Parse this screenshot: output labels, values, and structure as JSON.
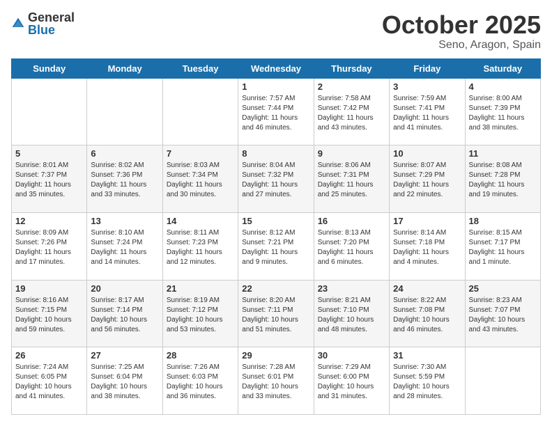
{
  "logo": {
    "general": "General",
    "blue": "Blue"
  },
  "header": {
    "month": "October 2025",
    "location": "Seno, Aragon, Spain"
  },
  "days": [
    "Sunday",
    "Monday",
    "Tuesday",
    "Wednesday",
    "Thursday",
    "Friday",
    "Saturday"
  ],
  "weeks": [
    [
      {
        "day": "",
        "sunrise": "",
        "sunset": "",
        "daylight": ""
      },
      {
        "day": "",
        "sunrise": "",
        "sunset": "",
        "daylight": ""
      },
      {
        "day": "",
        "sunrise": "",
        "sunset": "",
        "daylight": ""
      },
      {
        "day": "1",
        "sunrise": "Sunrise: 7:57 AM",
        "sunset": "Sunset: 7:44 PM",
        "daylight": "Daylight: 11 hours and 46 minutes."
      },
      {
        "day": "2",
        "sunrise": "Sunrise: 7:58 AM",
        "sunset": "Sunset: 7:42 PM",
        "daylight": "Daylight: 11 hours and 43 minutes."
      },
      {
        "day": "3",
        "sunrise": "Sunrise: 7:59 AM",
        "sunset": "Sunset: 7:41 PM",
        "daylight": "Daylight: 11 hours and 41 minutes."
      },
      {
        "day": "4",
        "sunrise": "Sunrise: 8:00 AM",
        "sunset": "Sunset: 7:39 PM",
        "daylight": "Daylight: 11 hours and 38 minutes."
      }
    ],
    [
      {
        "day": "5",
        "sunrise": "Sunrise: 8:01 AM",
        "sunset": "Sunset: 7:37 PM",
        "daylight": "Daylight: 11 hours and 35 minutes."
      },
      {
        "day": "6",
        "sunrise": "Sunrise: 8:02 AM",
        "sunset": "Sunset: 7:36 PM",
        "daylight": "Daylight: 11 hours and 33 minutes."
      },
      {
        "day": "7",
        "sunrise": "Sunrise: 8:03 AM",
        "sunset": "Sunset: 7:34 PM",
        "daylight": "Daylight: 11 hours and 30 minutes."
      },
      {
        "day": "8",
        "sunrise": "Sunrise: 8:04 AM",
        "sunset": "Sunset: 7:32 PM",
        "daylight": "Daylight: 11 hours and 27 minutes."
      },
      {
        "day": "9",
        "sunrise": "Sunrise: 8:06 AM",
        "sunset": "Sunset: 7:31 PM",
        "daylight": "Daylight: 11 hours and 25 minutes."
      },
      {
        "day": "10",
        "sunrise": "Sunrise: 8:07 AM",
        "sunset": "Sunset: 7:29 PM",
        "daylight": "Daylight: 11 hours and 22 minutes."
      },
      {
        "day": "11",
        "sunrise": "Sunrise: 8:08 AM",
        "sunset": "Sunset: 7:28 PM",
        "daylight": "Daylight: 11 hours and 19 minutes."
      }
    ],
    [
      {
        "day": "12",
        "sunrise": "Sunrise: 8:09 AM",
        "sunset": "Sunset: 7:26 PM",
        "daylight": "Daylight: 11 hours and 17 minutes."
      },
      {
        "day": "13",
        "sunrise": "Sunrise: 8:10 AM",
        "sunset": "Sunset: 7:24 PM",
        "daylight": "Daylight: 11 hours and 14 minutes."
      },
      {
        "day": "14",
        "sunrise": "Sunrise: 8:11 AM",
        "sunset": "Sunset: 7:23 PM",
        "daylight": "Daylight: 11 hours and 12 minutes."
      },
      {
        "day": "15",
        "sunrise": "Sunrise: 8:12 AM",
        "sunset": "Sunset: 7:21 PM",
        "daylight": "Daylight: 11 hours and 9 minutes."
      },
      {
        "day": "16",
        "sunrise": "Sunrise: 8:13 AM",
        "sunset": "Sunset: 7:20 PM",
        "daylight": "Daylight: 11 hours and 6 minutes."
      },
      {
        "day": "17",
        "sunrise": "Sunrise: 8:14 AM",
        "sunset": "Sunset: 7:18 PM",
        "daylight": "Daylight: 11 hours and 4 minutes."
      },
      {
        "day": "18",
        "sunrise": "Sunrise: 8:15 AM",
        "sunset": "Sunset: 7:17 PM",
        "daylight": "Daylight: 11 hours and 1 minute."
      }
    ],
    [
      {
        "day": "19",
        "sunrise": "Sunrise: 8:16 AM",
        "sunset": "Sunset: 7:15 PM",
        "daylight": "Daylight: 10 hours and 59 minutes."
      },
      {
        "day": "20",
        "sunrise": "Sunrise: 8:17 AM",
        "sunset": "Sunset: 7:14 PM",
        "daylight": "Daylight: 10 hours and 56 minutes."
      },
      {
        "day": "21",
        "sunrise": "Sunrise: 8:19 AM",
        "sunset": "Sunset: 7:12 PM",
        "daylight": "Daylight: 10 hours and 53 minutes."
      },
      {
        "day": "22",
        "sunrise": "Sunrise: 8:20 AM",
        "sunset": "Sunset: 7:11 PM",
        "daylight": "Daylight: 10 hours and 51 minutes."
      },
      {
        "day": "23",
        "sunrise": "Sunrise: 8:21 AM",
        "sunset": "Sunset: 7:10 PM",
        "daylight": "Daylight: 10 hours and 48 minutes."
      },
      {
        "day": "24",
        "sunrise": "Sunrise: 8:22 AM",
        "sunset": "Sunset: 7:08 PM",
        "daylight": "Daylight: 10 hours and 46 minutes."
      },
      {
        "day": "25",
        "sunrise": "Sunrise: 8:23 AM",
        "sunset": "Sunset: 7:07 PM",
        "daylight": "Daylight: 10 hours and 43 minutes."
      }
    ],
    [
      {
        "day": "26",
        "sunrise": "Sunrise: 7:24 AM",
        "sunset": "Sunset: 6:05 PM",
        "daylight": "Daylight: 10 hours and 41 minutes."
      },
      {
        "day": "27",
        "sunrise": "Sunrise: 7:25 AM",
        "sunset": "Sunset: 6:04 PM",
        "daylight": "Daylight: 10 hours and 38 minutes."
      },
      {
        "day": "28",
        "sunrise": "Sunrise: 7:26 AM",
        "sunset": "Sunset: 6:03 PM",
        "daylight": "Daylight: 10 hours and 36 minutes."
      },
      {
        "day": "29",
        "sunrise": "Sunrise: 7:28 AM",
        "sunset": "Sunset: 6:01 PM",
        "daylight": "Daylight: 10 hours and 33 minutes."
      },
      {
        "day": "30",
        "sunrise": "Sunrise: 7:29 AM",
        "sunset": "Sunset: 6:00 PM",
        "daylight": "Daylight: 10 hours and 31 minutes."
      },
      {
        "day": "31",
        "sunrise": "Sunrise: 7:30 AM",
        "sunset": "Sunset: 5:59 PM",
        "daylight": "Daylight: 10 hours and 28 minutes."
      },
      {
        "day": "",
        "sunrise": "",
        "sunset": "",
        "daylight": ""
      }
    ]
  ]
}
